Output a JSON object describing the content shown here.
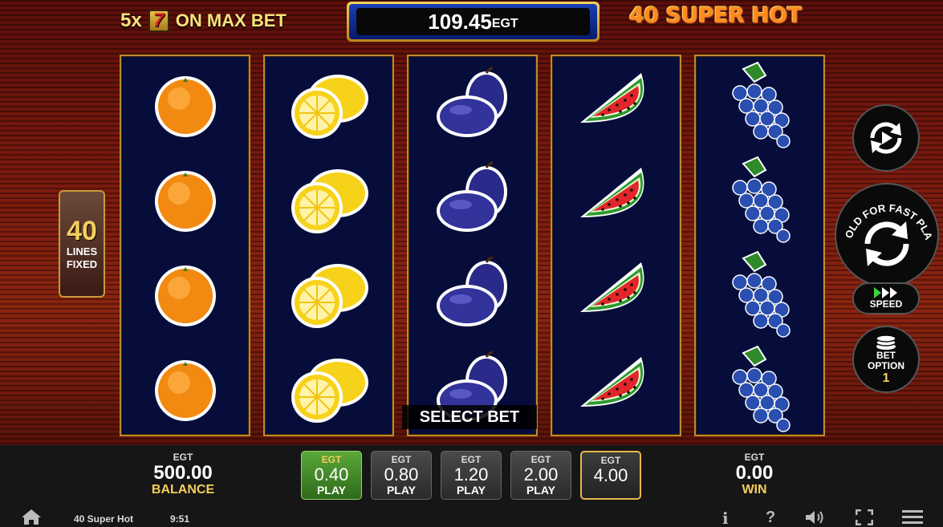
{
  "header": {
    "promo_prefix": "5x",
    "promo_symbol": "7",
    "promo_suffix": "ON MAX BET",
    "credit_value": "109.45",
    "credit_currency": "EGT",
    "game_logo": "40 SUPER HOT"
  },
  "reels": [
    {
      "symbol": "orange",
      "rows": 4
    },
    {
      "symbol": "lemon",
      "rows": 4
    },
    {
      "symbol": "plum",
      "rows": 4
    },
    {
      "symbol": "watermelon",
      "rows": 4
    },
    {
      "symbol": "grapes",
      "rows": 4
    }
  ],
  "select_bet_label": "SELECT BET",
  "lines": {
    "count": "40",
    "label_1": "LINES",
    "label_2": "FIXED"
  },
  "controls": {
    "autoplay_icon": "autoplay-icon",
    "spin_caption": "HOLD FOR FAST PLAY",
    "speed_label": "SPEED",
    "bet_option_label_1": "BET",
    "bet_option_label_2": "OPTION",
    "bet_option_value": "1"
  },
  "balance": {
    "currency": "EGT",
    "value": "500.00",
    "label": "BALANCE"
  },
  "win": {
    "currency": "EGT",
    "value": "0.00",
    "label": "WIN"
  },
  "bets": [
    {
      "currency": "EGT",
      "value": "0.40",
      "label": "PLAY",
      "state": "active"
    },
    {
      "currency": "EGT",
      "value": "0.80",
      "label": "PLAY",
      "state": "normal"
    },
    {
      "currency": "EGT",
      "value": "1.20",
      "label": "PLAY",
      "state": "normal"
    },
    {
      "currency": "EGT",
      "value": "2.00",
      "label": "PLAY",
      "state": "normal"
    },
    {
      "currency": "EGT",
      "value": "4.00",
      "label": "",
      "state": "selected"
    }
  ],
  "footer": {
    "game_name": "40 Super Hot",
    "time": "9:51",
    "icons": [
      "home-icon",
      "info-icon",
      "help-icon",
      "sound-icon",
      "fullscreen-icon",
      "menu-icon"
    ]
  },
  "colors": {
    "gold": "#f3cf5c",
    "reel_bg": "#060d3a",
    "active_bet": "#4c9a30",
    "logo": "#ff8a1e"
  }
}
